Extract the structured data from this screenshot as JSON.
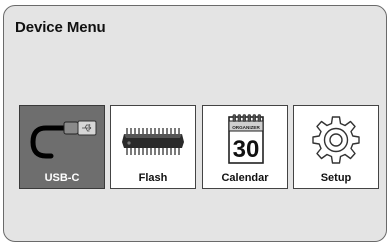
{
  "menu": {
    "title": "Device Menu",
    "selected_index": 0,
    "items": [
      {
        "label": "USB-C",
        "icon": "usb-cable-icon"
      },
      {
        "label": "Flash",
        "icon": "memory-chip-icon"
      },
      {
        "label": "Calendar",
        "icon": "calendar-icon",
        "calendar_header": "ORGANIZER",
        "calendar_day": "30"
      },
      {
        "label": "Setup",
        "icon": "gear-icon"
      }
    ]
  },
  "colors": {
    "panel_background": "#e4e4e4",
    "selected_tile": "#6e6e6e",
    "tile_background": "#ffffff"
  }
}
